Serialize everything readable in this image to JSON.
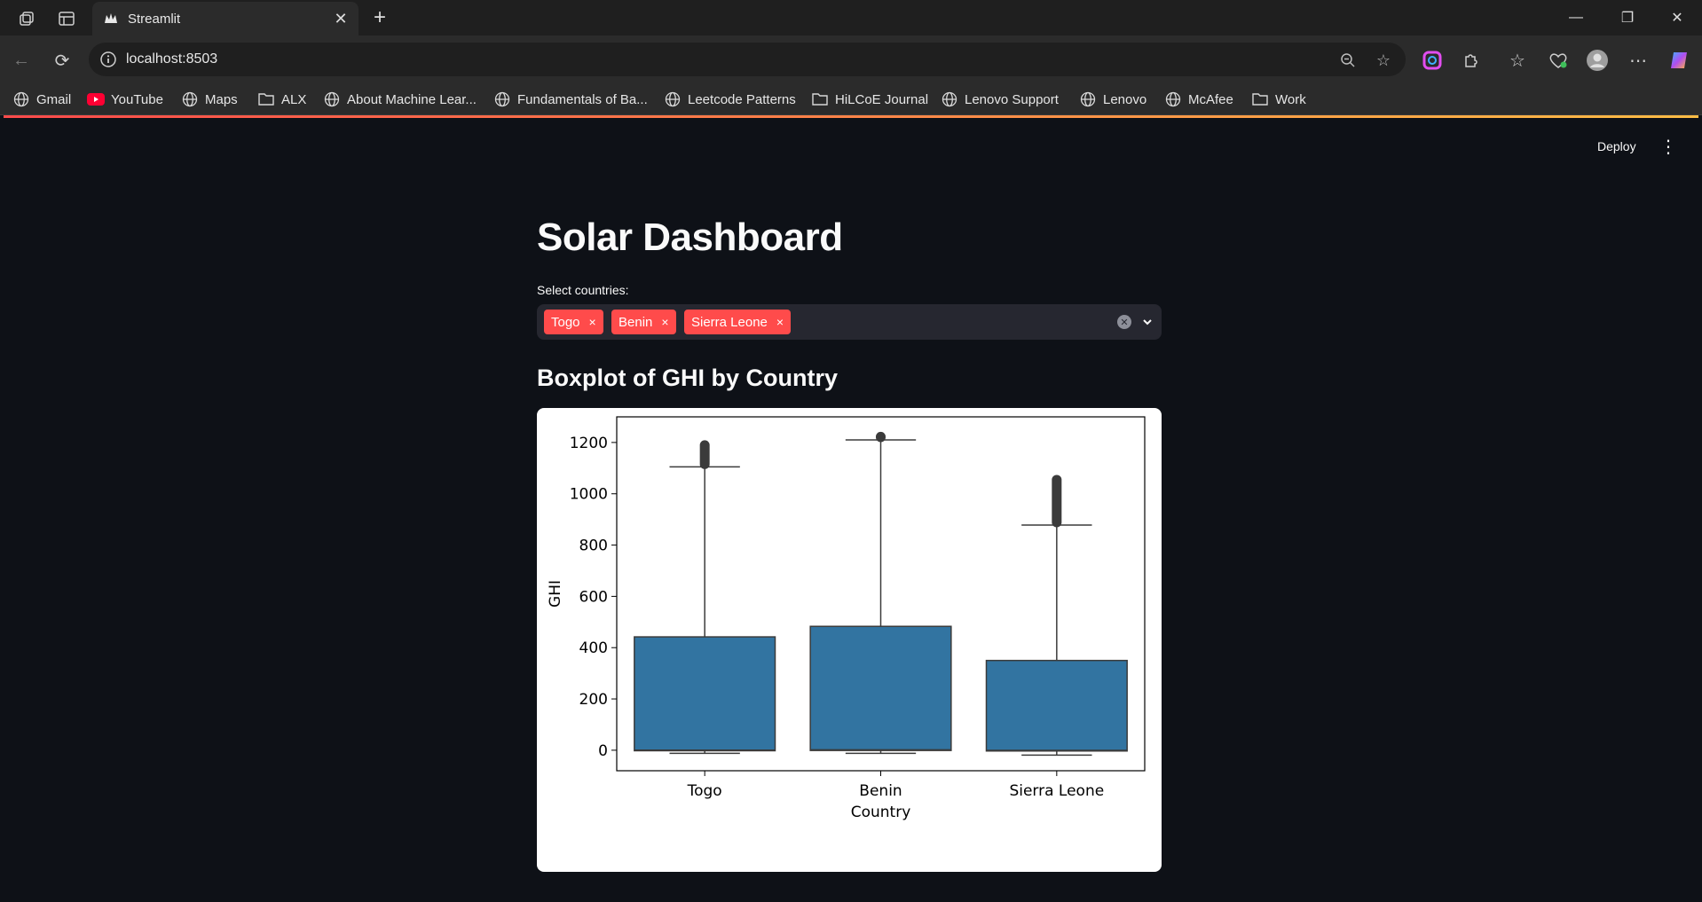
{
  "browser": {
    "tab_title": "Streamlit",
    "url": "localhost:8503",
    "bookmarks": [
      {
        "label": "Gmail",
        "icon": "globe-icon"
      },
      {
        "label": "YouTube",
        "icon": "youtube-icon"
      },
      {
        "label": "Maps",
        "icon": "globe-icon"
      },
      {
        "label": "ALX",
        "icon": "folder-icon"
      },
      {
        "label": "About Machine Lear...",
        "icon": "globe-icon"
      },
      {
        "label": "Fundamentals of Ba...",
        "icon": "globe-icon"
      },
      {
        "label": "Leetcode Patterns",
        "icon": "globe-icon"
      },
      {
        "label": "HiLCoE Journal",
        "icon": "folder-icon"
      },
      {
        "label": "Lenovo Support",
        "icon": "globe-icon"
      },
      {
        "label": "Lenovo",
        "icon": "globe-icon"
      },
      {
        "label": "McAfee",
        "icon": "globe-icon"
      },
      {
        "label": "Work",
        "icon": "folder-icon"
      }
    ]
  },
  "app": {
    "deploy_label": "Deploy",
    "title": "Solar Dashboard",
    "select_label": "Select countries:",
    "selected": [
      "Togo",
      "Benin",
      "Sierra Leone"
    ],
    "chip_close": "×",
    "subheader": "Boxplot of GHI by Country",
    "accent_color": "#ff4b4b",
    "background_color": "#0e1117"
  },
  "chart_data": {
    "type": "boxplot",
    "xlabel": "Country",
    "ylabel": "GHI",
    "ylim": [
      -80,
      1300
    ],
    "yticks": [
      0,
      200,
      400,
      600,
      800,
      1000,
      1200
    ],
    "categories": [
      "Togo",
      "Benin",
      "Sierra Leone"
    ],
    "box_color": "#3274a1",
    "boxes": [
      {
        "name": "Togo",
        "whisker_low": -12,
        "q1": -2,
        "median": 0,
        "q3": 442,
        "whisker_high": 1105,
        "outliers_range": [
          1105,
          1200
        ]
      },
      {
        "name": "Benin",
        "whisker_low": -12,
        "q1": -1,
        "median": 1,
        "q3": 483,
        "whisker_high": 1210,
        "outliers_range": [
          1210,
          1233
        ]
      },
      {
        "name": "Sierra Leone",
        "whisker_low": -19,
        "q1": -3,
        "median": -1,
        "q3": 350,
        "whisker_high": 878,
        "outliers_range": [
          878,
          1065
        ]
      }
    ]
  }
}
